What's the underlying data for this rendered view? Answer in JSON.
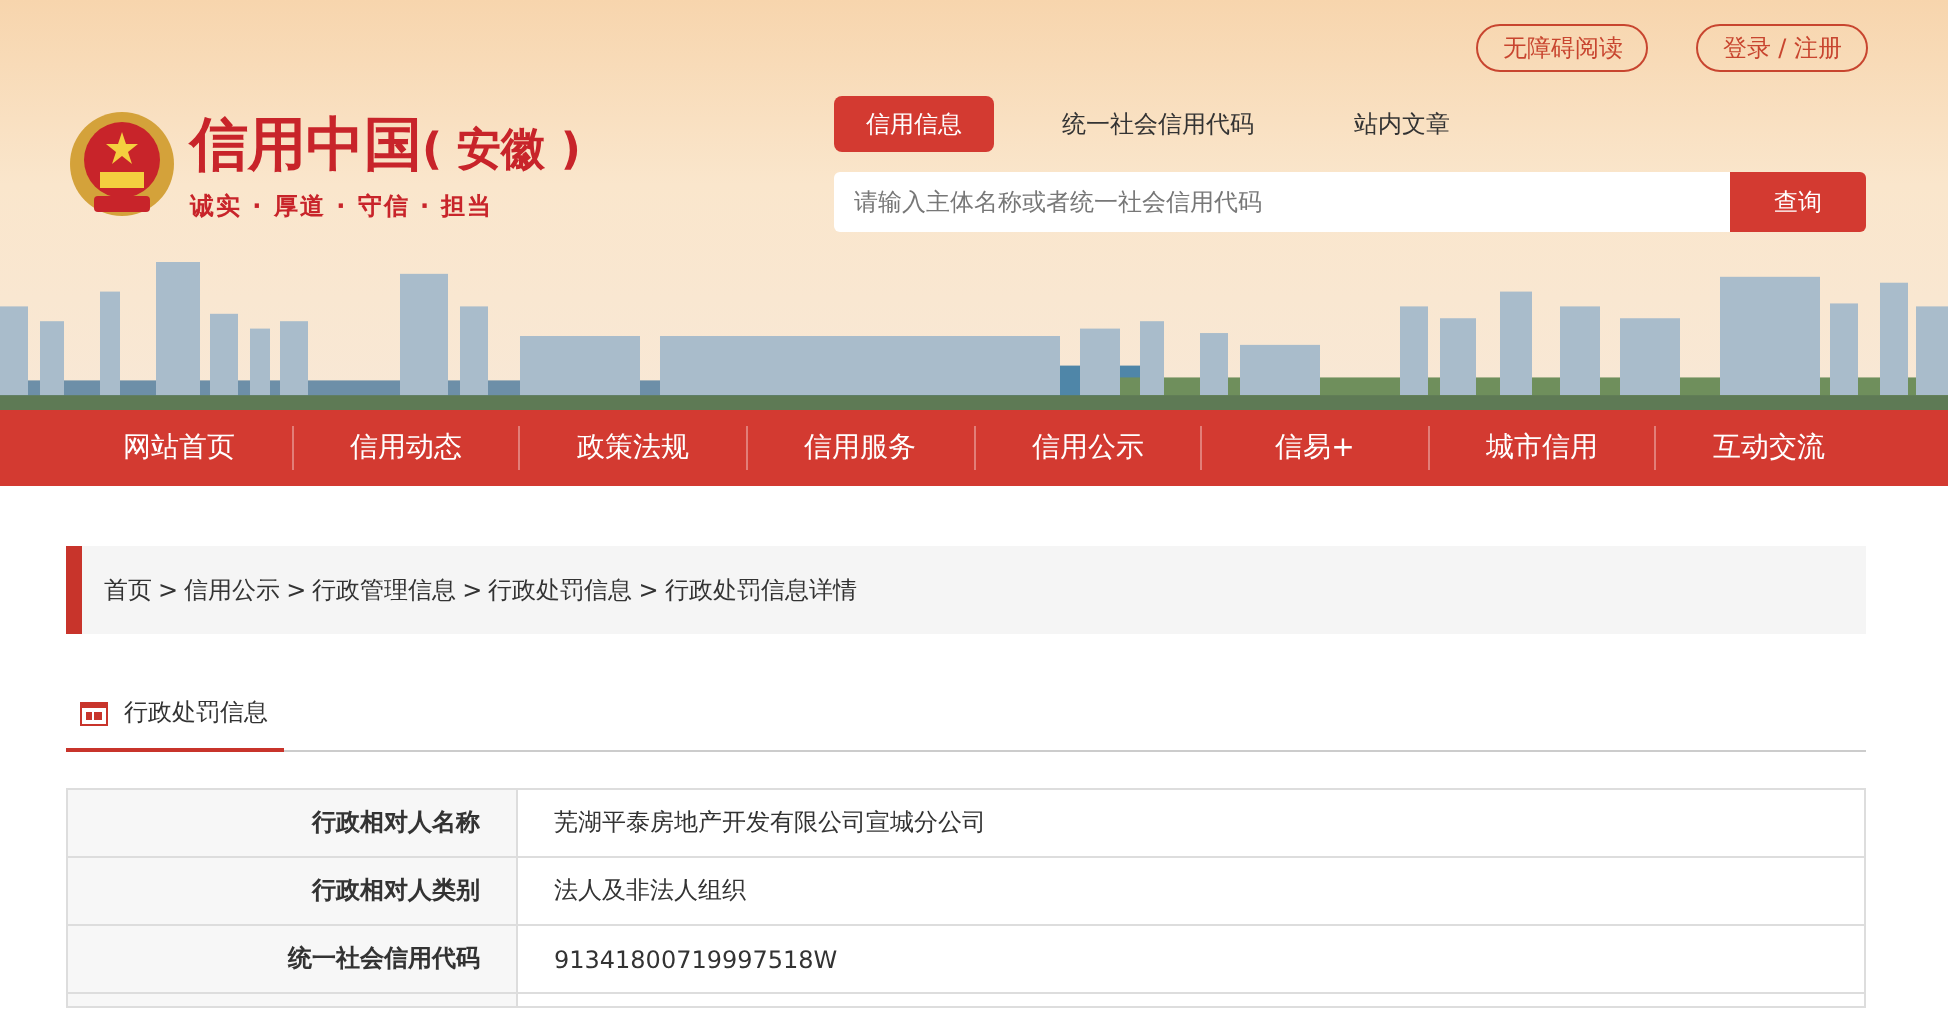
{
  "header": {
    "site_title": "信用中国",
    "region": "( 安徽 )",
    "slogan": "诚实 · 厚道 · 守信 · 担当",
    "top_links": [
      "无障碍阅读",
      "登录 / 注册"
    ]
  },
  "search": {
    "tabs": [
      {
        "label": "信用信息",
        "selected": true
      },
      {
        "label": "统一社会信用代码",
        "selected": false
      },
      {
        "label": "站内文章",
        "selected": false
      }
    ],
    "placeholder": "请输入主体名称或者统一社会信用代码",
    "button": "查询"
  },
  "nav": [
    "网站首页",
    "信用动态",
    "政策法规",
    "信用服务",
    "信用公示",
    "信易+",
    "城市信用",
    "互动交流"
  ],
  "breadcrumb": {
    "separator": ">",
    "items": [
      "首页",
      "信用公示",
      "行政管理信息",
      "行政处罚信息",
      "行政处罚信息详情"
    ]
  },
  "section_tab": "行政处罚信息",
  "table": {
    "rows": [
      {
        "label": "行政相对人名称",
        "value": "芜湖平泰房地产开发有限公司宣城分公司"
      },
      {
        "label": "行政相对人类别",
        "value": "法人及非法人组织"
      },
      {
        "label": "统一社会信用代码",
        "value": "91341800719997518W"
      }
    ]
  }
}
